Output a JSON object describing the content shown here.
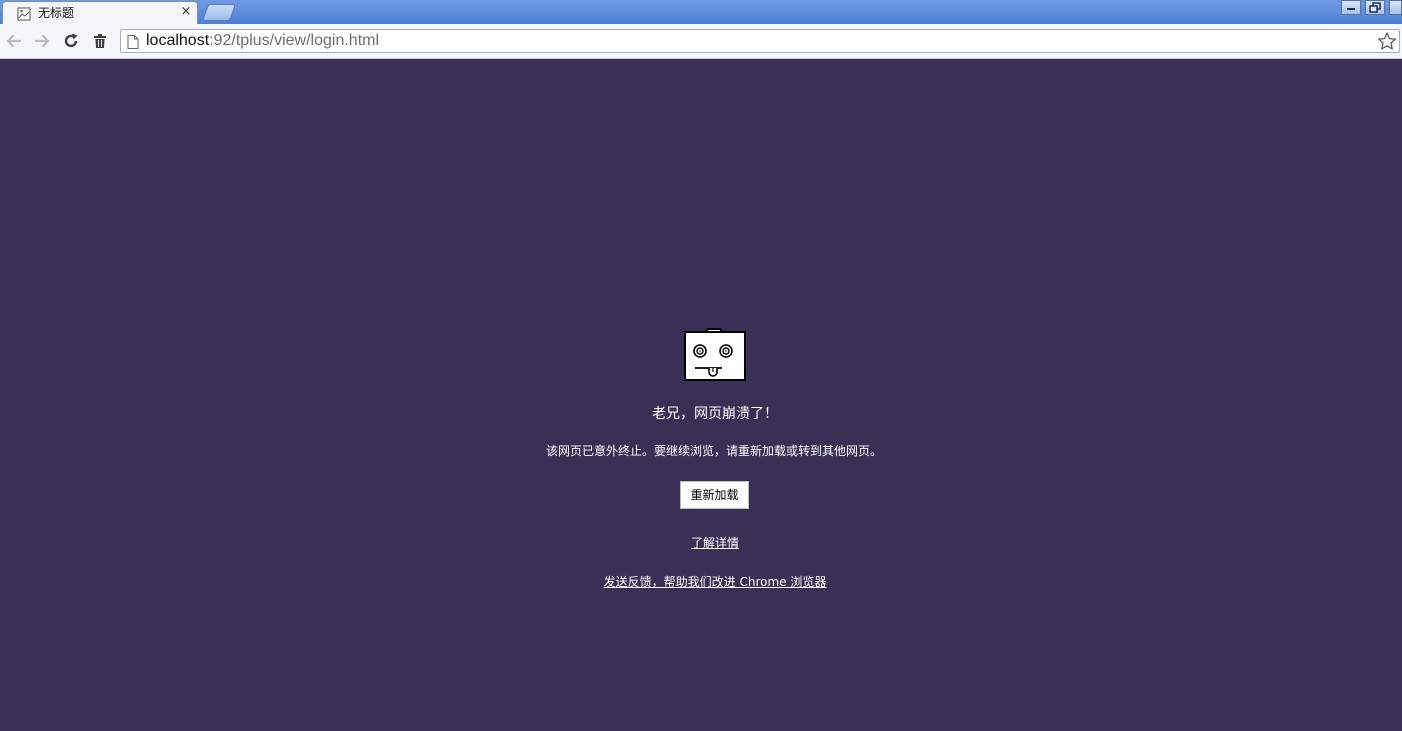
{
  "window": {
    "tab": {
      "title": "无标题",
      "favicon": "page-fold-icon",
      "close_glyph": "×"
    },
    "controls": [
      "minimize-icon",
      "restore-icon"
    ]
  },
  "toolbar": {
    "back_icon": "back-arrow-icon",
    "forward_icon": "forward-arrow-icon",
    "reload_icon": "reload-icon",
    "extra_icon": "trash-icon",
    "url_host": "localhost",
    "url_rest": ":92/tplus/view/login.html",
    "bookmark_icon": "star-icon"
  },
  "crash_page": {
    "background": "#3a3056",
    "icon": "sad-tab-icon",
    "title": "老兄，网页崩溃了！",
    "message": "该网页已意外终止。要继续浏览，请重新加载或转到其他网页。",
    "reload_label": "重新加载",
    "learn_more": "了解详情",
    "feedback": "发送反馈，帮助我们改进 Chrome 浏览器"
  }
}
